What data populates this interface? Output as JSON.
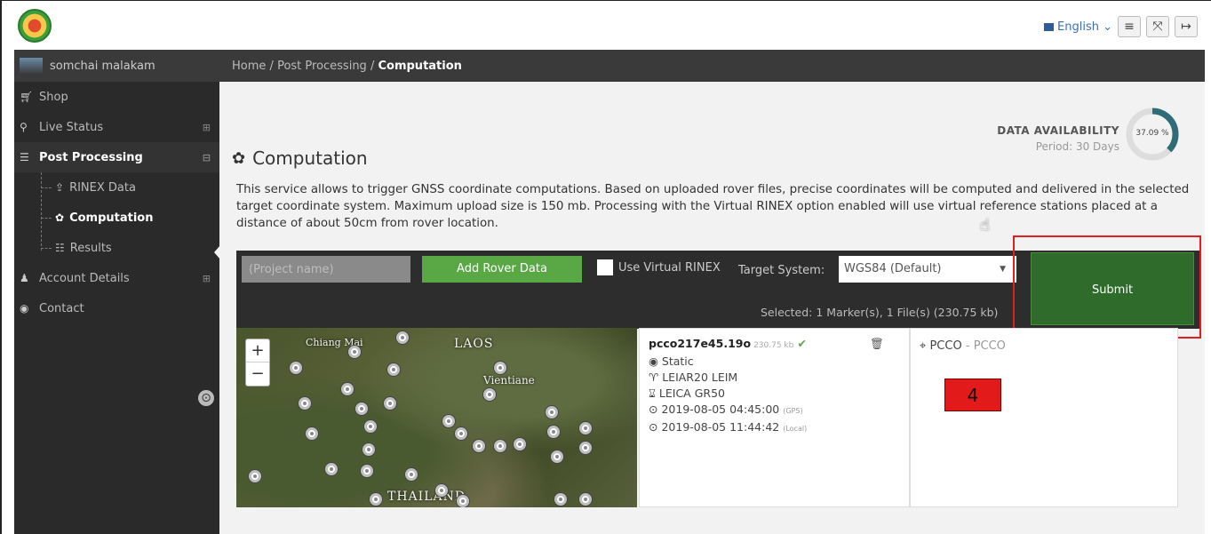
{
  "topbar": {
    "language": "English",
    "icons": [
      "list-icon",
      "fullscreen-icon",
      "logout-icon"
    ]
  },
  "sidebar": {
    "user": "somchai malakam",
    "items": [
      {
        "label": "Shop",
        "icon": "cart-icon"
      },
      {
        "label": "Live Status",
        "icon": "live-icon",
        "expander": "⊞"
      },
      {
        "label": "Post Processing",
        "icon": "database-icon",
        "expander": "⊟"
      },
      {
        "label": "Account Details",
        "icon": "user-icon",
        "expander": "⊞"
      },
      {
        "label": "Contact",
        "icon": "contact-icon"
      }
    ],
    "subitems": [
      {
        "label": "RINEX Data",
        "icon": "upload-icon"
      },
      {
        "label": "Computation",
        "icon": "gear-icon"
      },
      {
        "label": "Results",
        "icon": "list-icon"
      }
    ]
  },
  "breadcrumb": {
    "home": "Home",
    "sep": "/",
    "section": "Post Processing",
    "current": "Computation"
  },
  "page": {
    "title": "Computation",
    "availability_heading": "DATA AVAILABILITY",
    "availability_period": "Period: 30 Days",
    "availability_percent": "37.09 %",
    "availability_fraction": 0.3709,
    "description": "This service allows to trigger GNSS coordinate computations. Based on uploaded rover files, precise coordinates will be computed and delivered in the selected target coordinate system. Maximum upload size is 150 mb. Processing with the Virtual RINEX option enabled will use virtual reference stations placed at a distance of about 50cm from rover location."
  },
  "toolbar": {
    "project_placeholder": "(Project name)",
    "add_rover": "Add Rover Data",
    "virtual_rinex": "Use Virtual RINEX",
    "target_label": "Target System:",
    "target_value": "WGS84 (Default)",
    "selected": "Selected:  1 Marker(s), 1 File(s) (230.75 kb)",
    "submit": "Submit"
  },
  "map": {
    "labels": [
      "Chiang Mai",
      "LAOS",
      "Vientiane",
      "THAILAND"
    ],
    "zoom_in": "+",
    "zoom_out": "−"
  },
  "file": {
    "name": "pcco217e45.19o",
    "size": "230.75 kb",
    "mode": "Static",
    "antenna": "LEIAR20 LEIM",
    "receiver": "LEICA GR50",
    "start": "2019-08-05 04:45:00",
    "start_tz": "(GPS)",
    "end": "2019-08-05 11:44:42",
    "end_tz": "(Local)"
  },
  "station": {
    "code": "PCCO",
    "alt": "PCCO",
    "sep": "-"
  },
  "annotation": {
    "step": "4"
  },
  "colors": {
    "submit": "#2f6b2a",
    "add_rover": "#5aa845",
    "highlight": "#e02020"
  }
}
